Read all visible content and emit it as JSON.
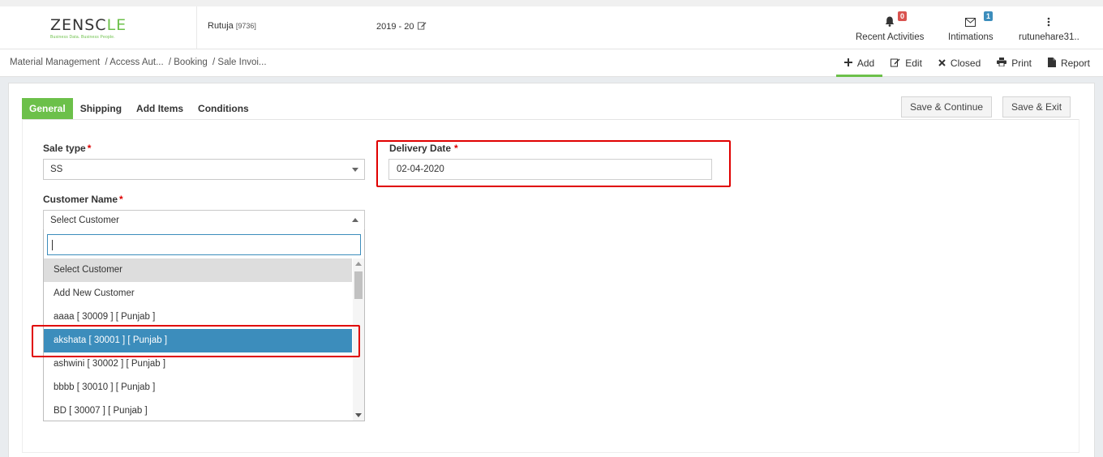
{
  "app": {
    "logo_text_a": "ZENSC",
    "logo_text_b": "LE",
    "logo_tagline": "Business Data. Business People.",
    "user_name": "Rutuja",
    "user_id": "[9736]",
    "fiscal_year": "2019 - 20"
  },
  "topnav": {
    "recent_activities": {
      "label": "Recent Activities",
      "count": "0"
    },
    "intimations": {
      "label": "Intimations",
      "count": "1"
    },
    "user_menu": {
      "label": "rutunehare31.."
    }
  },
  "breadcrumb": {
    "items": [
      "Material Management",
      "/ Access Aut...",
      "/ Booking",
      "/ Sale Invoi..."
    ]
  },
  "actions": {
    "add": "Add",
    "edit": "Edit",
    "closed": "Closed",
    "print": "Print",
    "report": "Report"
  },
  "tabs": [
    "General",
    "Shipping",
    "Add Items",
    "Conditions"
  ],
  "buttons": {
    "save_continue": "Save & Continue",
    "save_exit": "Save & Exit"
  },
  "form": {
    "sale_type": {
      "label": "Sale type",
      "required": "*",
      "value": "SS"
    },
    "delivery_date": {
      "label": "Delivery Date",
      "required": "*",
      "value": "02-04-2020"
    },
    "customer_name": {
      "label": "Customer Name",
      "required": "*",
      "value": "Select Customer"
    }
  },
  "dropdown": {
    "search_value": "",
    "options": [
      "Select Customer",
      "Add New Customer",
      "aaaa [ 30009 ] [ Punjab ]",
      "akshata [ 30001 ] [ Punjab ]",
      "ashwini [ 30002 ] [ Punjab ]",
      "bbbb [ 30010 ] [ Punjab ]",
      "BD [ 30007 ] [ Punjab ]"
    ],
    "hovered_index": 0,
    "selected_index": 3
  },
  "colors": {
    "accent_green": "#6cc04a",
    "select_blue": "#3c8dbc",
    "highlight_red": "#e00000",
    "badge_red": "#d9534f"
  }
}
